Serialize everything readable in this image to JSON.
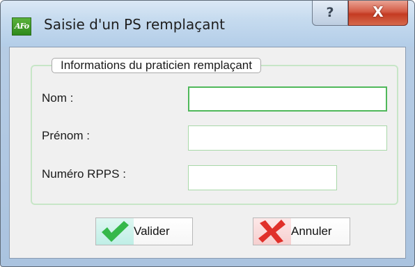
{
  "window": {
    "title": "Saisie d'un PS remplaçant",
    "app_icon_text": "AFo",
    "help_label": "?",
    "close_label": "X"
  },
  "group": {
    "legend": "Informations du praticien remplaçant"
  },
  "fields": {
    "nom": {
      "label": "Nom :",
      "value": ""
    },
    "prenom": {
      "label": "Prénom :",
      "value": ""
    },
    "rpps": {
      "label": "Numéro RPPS :",
      "value": ""
    }
  },
  "buttons": {
    "valider": "Valider",
    "annuler": "Annuler"
  },
  "colors": {
    "accent_green": "#4fb85a",
    "close_red": "#c43a22",
    "cancel_icon_red": "#e0302a",
    "validate_icon_green": "#35b84a"
  },
  "icons": {
    "app": "app-logo-icon",
    "help": "help-icon",
    "close": "close-icon",
    "validate": "check-icon",
    "cancel": "cross-icon"
  }
}
